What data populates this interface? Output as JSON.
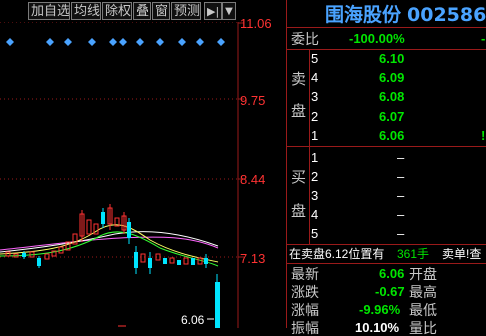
{
  "toolbar": {
    "buttons": [
      "加自选",
      "均线",
      "除权",
      "叠",
      "窗",
      "预测"
    ],
    "expand_icon": "expand-right-icon",
    "dropdown_icon": "dropdown-arrow-icon"
  },
  "price_axis": {
    "labels": [
      "11.06",
      "9.75",
      "8.44",
      "7.13"
    ],
    "low_marker": "6.06",
    "low_marker_arrow": "←"
  },
  "stock": {
    "name": "围海股份",
    "code": "002586"
  },
  "order_book": {
    "ratio_label": "委比",
    "ratio_value": "-100.00%",
    "sell_label_1": "卖",
    "sell_label_2": "盘",
    "buy_label_1": "买",
    "buy_label_2": "盘",
    "sell": [
      {
        "level": "5",
        "price": "6.10"
      },
      {
        "level": "4",
        "price": "6.09"
      },
      {
        "level": "3",
        "price": "6.08"
      },
      {
        "level": "2",
        "price": "6.07"
      },
      {
        "level": "1",
        "price": "6.06"
      }
    ],
    "buy": [
      {
        "level": "1",
        "price": "–"
      },
      {
        "level": "2",
        "price": "–"
      },
      {
        "level": "3",
        "price": "–"
      },
      {
        "level": "4",
        "price": "–"
      },
      {
        "level": "5",
        "price": "–"
      }
    ]
  },
  "notice": {
    "text": "在卖盘6.12位置有",
    "volume": "361手",
    "tag": "卖单!查"
  },
  "quote": {
    "rows": [
      {
        "label": "最新",
        "value": "6.06",
        "label2": "开盘"
      },
      {
        "label": "涨跌",
        "value": "-0.67",
        "label2": "最高"
      },
      {
        "label": "涨幅",
        "value": "-9.96%",
        "label2": "最低"
      },
      {
        "label": "振幅",
        "value": "10.10%",
        "label2": "量比"
      }
    ]
  },
  "colors": {
    "up": "#ff3232",
    "down": "#00e600",
    "blue_text": "#4aa3ff",
    "grid": "#9a1a1a"
  }
}
